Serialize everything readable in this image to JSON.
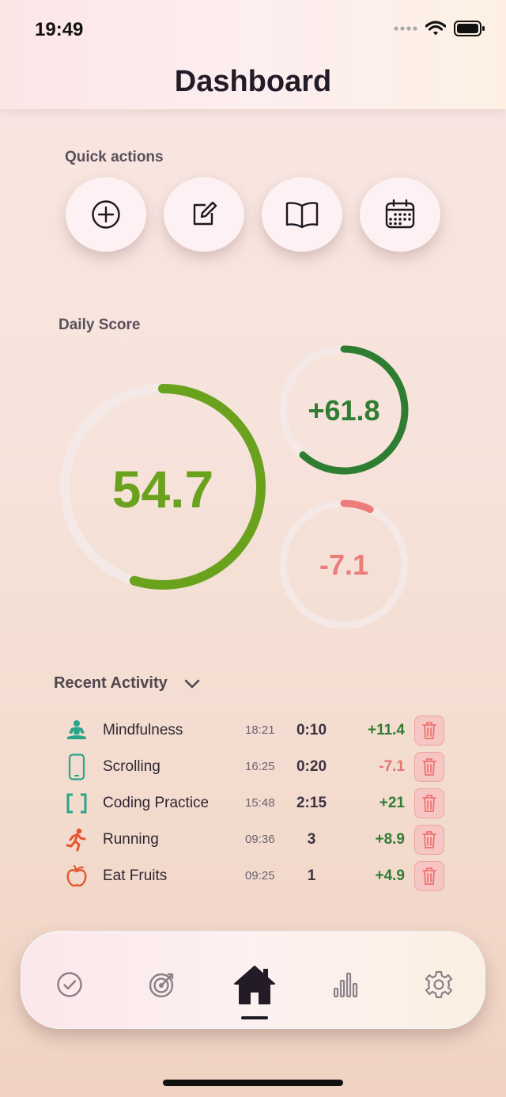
{
  "status": {
    "time": "19:49"
  },
  "header": {
    "title": "Dashboard"
  },
  "quick_actions": {
    "label": "Quick actions",
    "buttons": [
      {
        "icon": "add-circle-icon"
      },
      {
        "icon": "edit-note-icon"
      },
      {
        "icon": "book-icon"
      },
      {
        "icon": "calendar-icon"
      }
    ]
  },
  "daily_score": {
    "label": "Daily Score",
    "main": {
      "value": "54.7",
      "progress": 0.547,
      "color": "#6aa21e"
    },
    "positive": {
      "value": "+61.8",
      "progress": 0.618,
      "color": "#2f7d32"
    },
    "negative": {
      "value": "-7.1",
      "progress": 0.071,
      "color": "#ec7d7a"
    }
  },
  "activity": {
    "title": "Recent Activity",
    "items": [
      {
        "icon": "meditation-icon",
        "name": "Mindfulness",
        "time": "18:21",
        "duration": "0:10",
        "score": "+11.4",
        "positive": true
      },
      {
        "icon": "phone-icon",
        "name": "Scrolling",
        "time": "16:25",
        "duration": "0:20",
        "score": "-7.1",
        "positive": false
      },
      {
        "icon": "code-brackets-icon",
        "name": "Coding Practice",
        "time": "15:48",
        "duration": "2:15",
        "score": "+21",
        "positive": true
      },
      {
        "icon": "running-icon",
        "name": "Running",
        "time": "09:36",
        "duration": "3",
        "score": "+8.9",
        "positive": true
      },
      {
        "icon": "apple-icon",
        "name": "Eat Fruits",
        "time": "09:25",
        "duration": "1",
        "score": "+4.9",
        "positive": true
      }
    ]
  },
  "tabs": [
    {
      "icon": "check-circle-icon"
    },
    {
      "icon": "target-icon"
    },
    {
      "icon": "home-icon",
      "active": true
    },
    {
      "icon": "bar-chart-icon"
    },
    {
      "icon": "settings-gear-icon"
    }
  ],
  "colors": {
    "positive": "#2e7d32",
    "negative": "#e57373",
    "accent": "#6aa21e"
  }
}
